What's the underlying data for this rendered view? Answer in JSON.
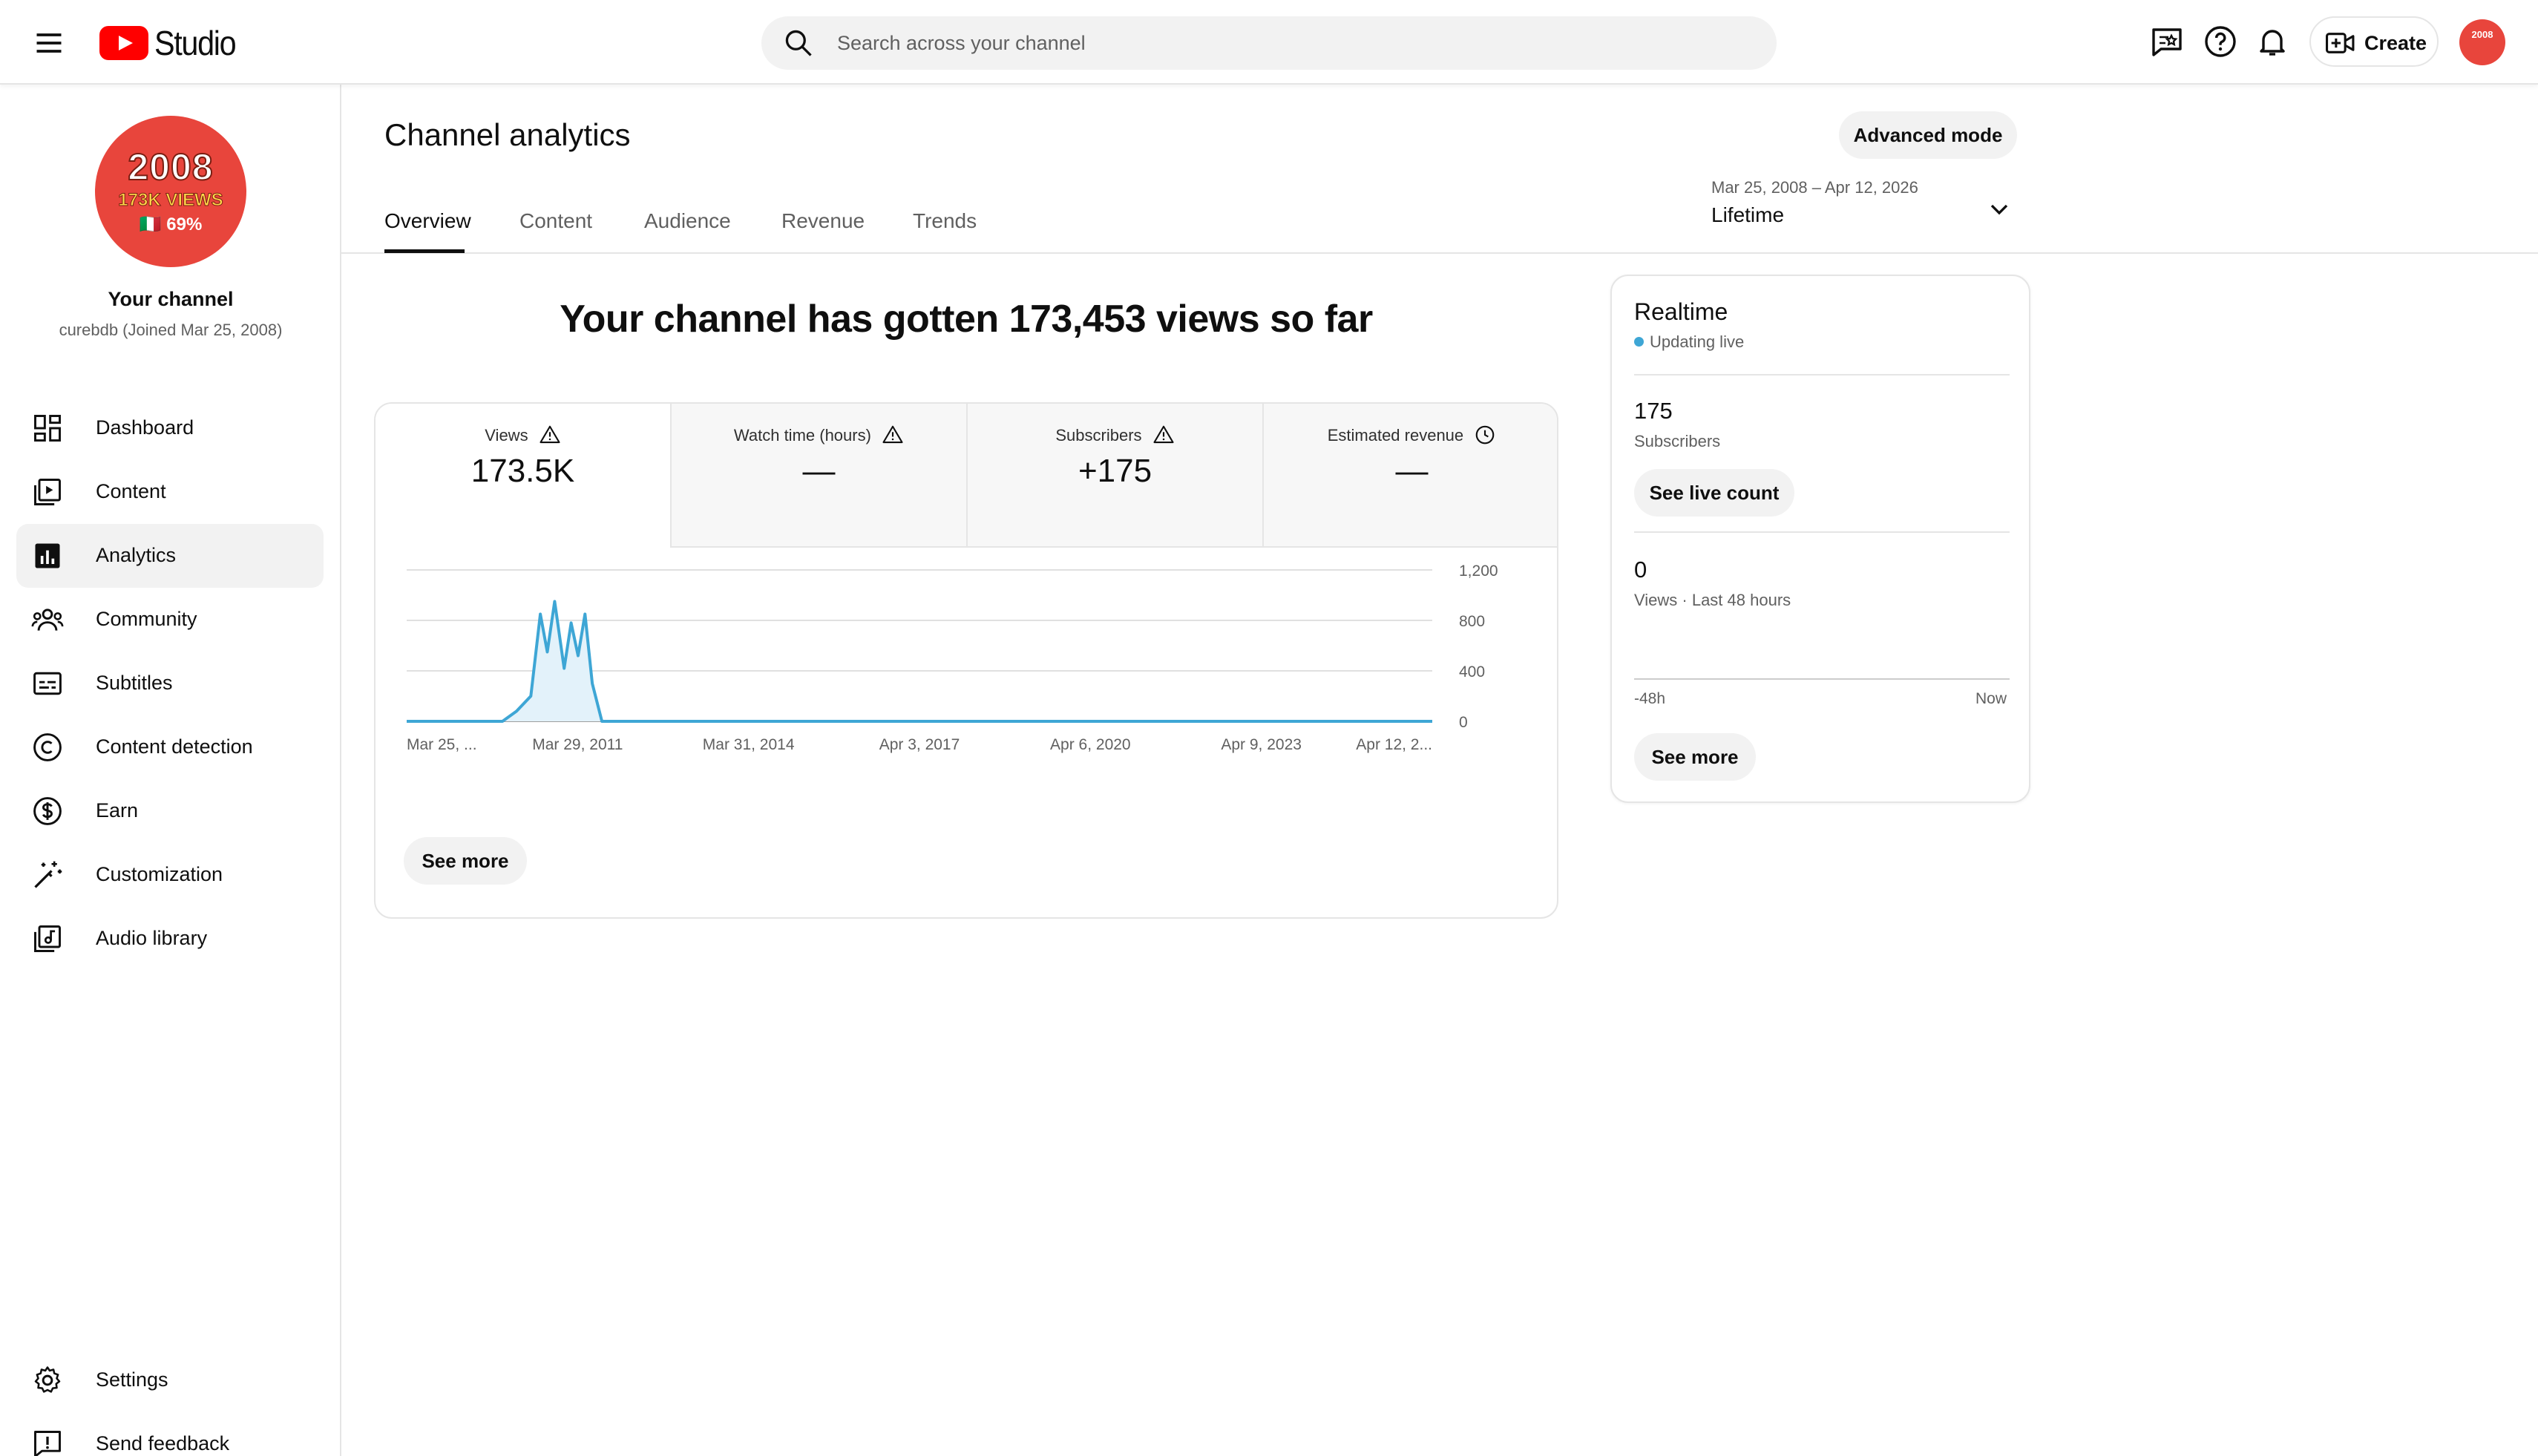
{
  "header": {
    "logo_text": "Studio",
    "search_placeholder": "Search across your channel",
    "create_label": "Create",
    "avatar_text": "2008"
  },
  "sidebar": {
    "avatar": {
      "year": "2008",
      "views_text": "173K VIEWS",
      "pct_text": "🇮🇹 69%"
    },
    "channel_title": "Your channel",
    "channel_sub": "curebdb (Joined Mar 25, 2008)",
    "items": [
      {
        "label": "Dashboard",
        "icon": "dashboard-icon"
      },
      {
        "label": "Content",
        "icon": "content-icon"
      },
      {
        "label": "Analytics",
        "icon": "analytics-icon",
        "active": true
      },
      {
        "label": "Community",
        "icon": "community-icon"
      },
      {
        "label": "Subtitles",
        "icon": "subtitles-icon"
      },
      {
        "label": "Content detection",
        "icon": "copyright-icon"
      },
      {
        "label": "Earn",
        "icon": "dollar-icon"
      },
      {
        "label": "Customization",
        "icon": "magic-wand-icon"
      },
      {
        "label": "Audio library",
        "icon": "audio-library-icon"
      }
    ],
    "bottom_items": [
      {
        "label": "Settings",
        "icon": "gear-icon"
      },
      {
        "label": "Send feedback",
        "icon": "feedback-icon"
      }
    ]
  },
  "main": {
    "title": "Channel analytics",
    "advanced_mode": "Advanced mode",
    "date_range": "Mar 25, 2008 – Apr 12, 2026",
    "date_label": "Lifetime",
    "tabs": [
      "Overview",
      "Content",
      "Audience",
      "Revenue",
      "Trends"
    ],
    "active_tab": "Overview",
    "headline": "Your channel has gotten 173,453 views so far",
    "metrics": [
      {
        "label": "Views",
        "value": "173.5K",
        "icon": "warning-icon"
      },
      {
        "label": "Watch time (hours)",
        "value": "—",
        "icon": "warning-icon"
      },
      {
        "label": "Subscribers",
        "value": "+175",
        "icon": "warning-icon"
      },
      {
        "label": "Estimated revenue",
        "value": "—",
        "icon": "clock-icon"
      }
    ],
    "see_more": "See more"
  },
  "realtime": {
    "title": "Realtime",
    "status": "Updating live",
    "subscribers_value": "175",
    "subscribers_label": "Subscribers",
    "live_count_btn": "See live count",
    "views_value": "0",
    "views_label": "Views · Last 48 hours",
    "axis_start": "-48h",
    "axis_end": "Now",
    "see_more": "See more"
  },
  "colors": {
    "accent_red": "#ff0000",
    "avatar_red": "#e8453c",
    "chart_line": "#3ea6d5",
    "chart_fill": "#e3f2fa"
  },
  "chart_data": {
    "type": "line",
    "series": [
      {
        "values_x": [
          "2008-03-25",
          "2009-12-01",
          "2010-03-01",
          "2010-06-01",
          "2010-08-01",
          "2010-09-15",
          "2010-11-01",
          "2011-01-01",
          "2011-02-15",
          "2011-04-01",
          "2011-05-15",
          "2011-07-01",
          "2011-09-01",
          "2012-01-01",
          "2026-04-12"
        ],
        "values_y": [
          0,
          0,
          80,
          200,
          850,
          550,
          950,
          420,
          780,
          520,
          850,
          300,
          0,
          0,
          0
        ]
      }
    ],
    "x_ticks": [
      "Mar 25, ...",
      "Mar 29, 2011",
      "Mar 31, 2014",
      "Apr 3, 2017",
      "Apr 6, 2020",
      "Apr 9, 2023",
      "Apr 12, 2..."
    ],
    "y_ticks": [
      "0",
      "400",
      "800",
      "1,200"
    ],
    "ylim": [
      0,
      1200
    ],
    "xlim": [
      "2008-03-25",
      "2026-04-12"
    ],
    "grid": true
  }
}
